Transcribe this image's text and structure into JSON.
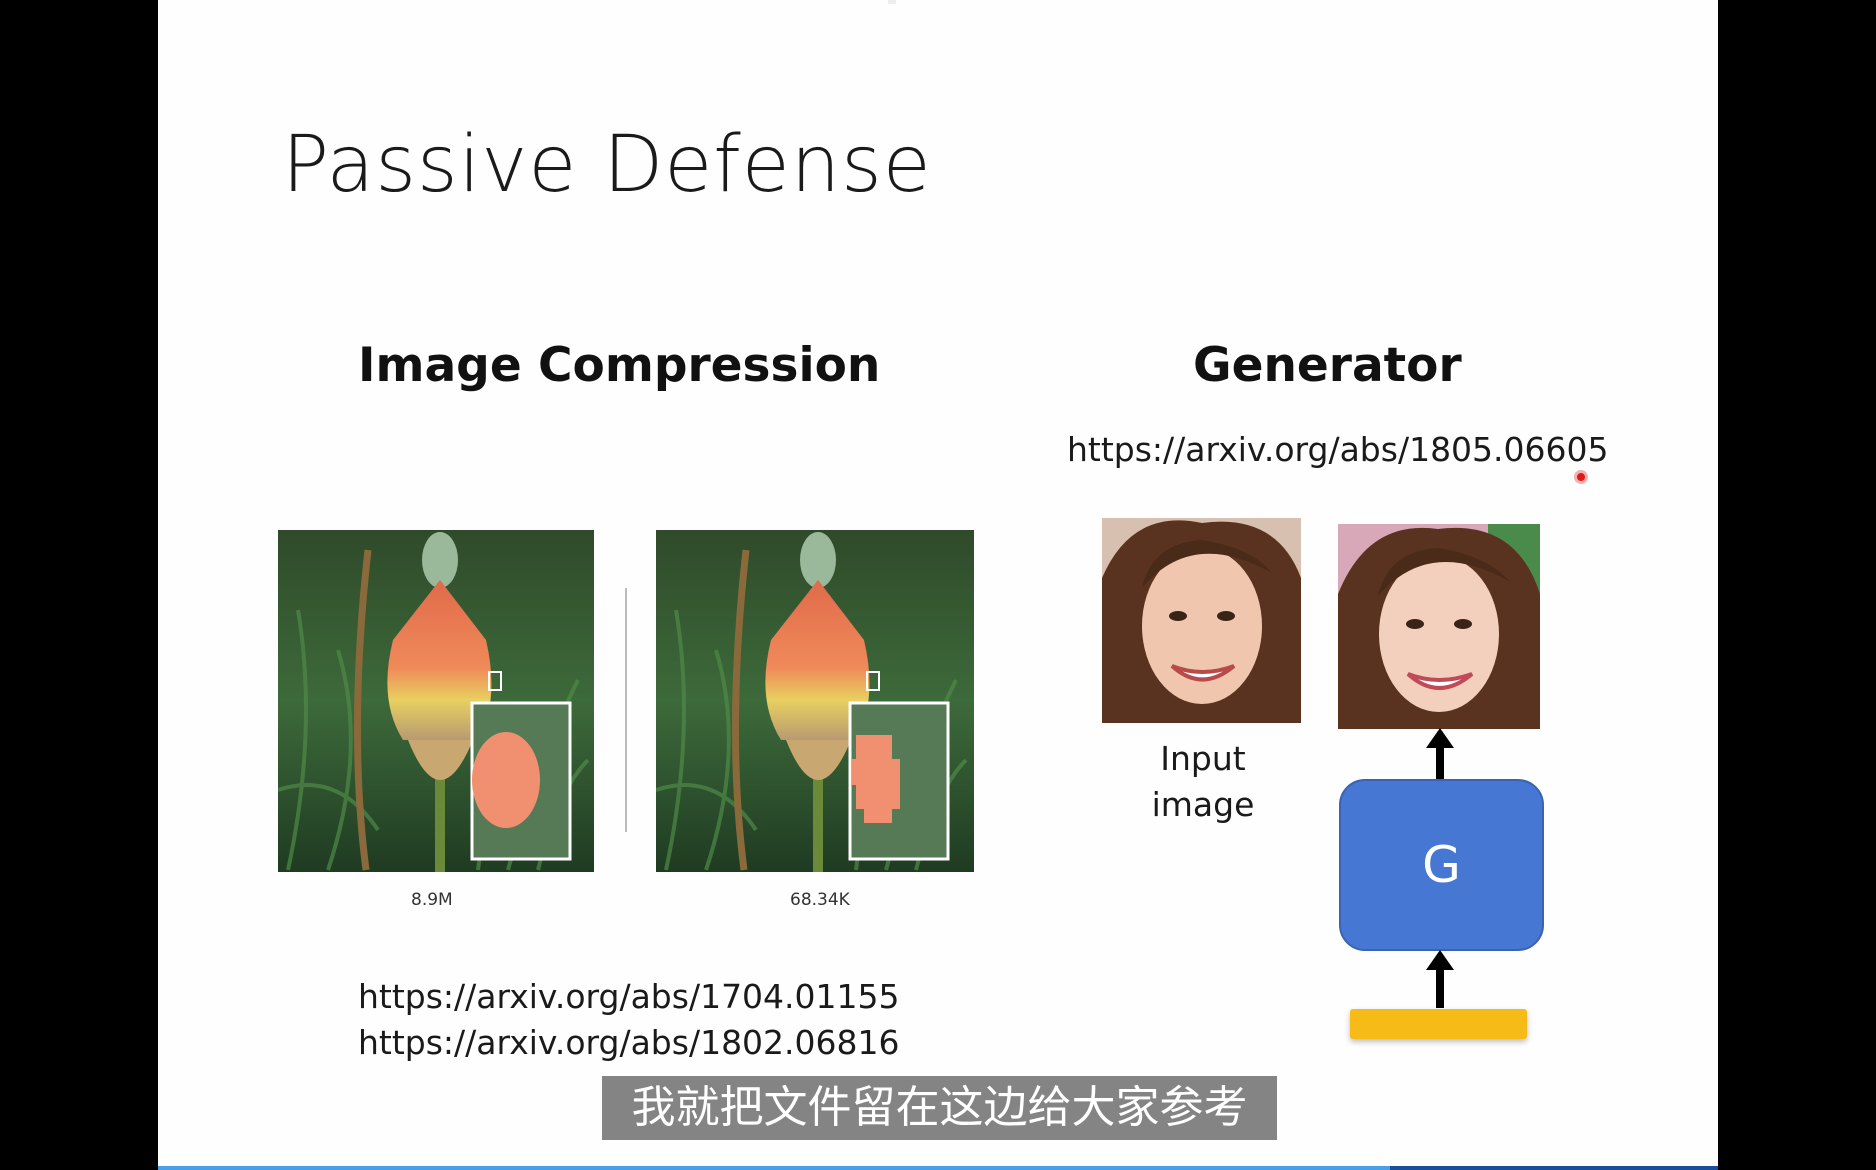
{
  "slide": {
    "title": "Passive Defense",
    "left_heading": "Image Compression",
    "right_heading": "Generator",
    "generator_url": "https://arxiv.org/abs/1805.06605",
    "compression_urls": [
      "https://arxiv.org/abs/1704.01155",
      "https://arxiv.org/abs/1802.06816"
    ],
    "captions": [
      "8.9M",
      "68.34K"
    ],
    "input_label": "Input image",
    "g_label": "G"
  },
  "subtitle": "我就把文件留在这边给大家参考",
  "progress": 0.79,
  "colors": {
    "generator_box": "#4677d2",
    "noise_bar": "#f6bb16",
    "laser_pointer": "#e01a1a"
  },
  "icons": {
    "arrows": "arrow-up-icon",
    "pointer": "laser-pointer-icon"
  }
}
